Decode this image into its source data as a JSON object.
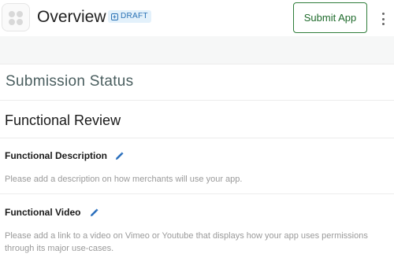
{
  "header": {
    "app_icon": "app-placeholder-icon",
    "title": "Overview",
    "badge": {
      "icon": "plus-square-icon",
      "label": "DRAFT"
    },
    "submit_label": "Submit App",
    "more_icon": "kebab-menu-icon"
  },
  "main": {
    "status_heading": "Submission Status",
    "section_title": "Functional Review",
    "fields": [
      {
        "label": "Functional Description",
        "edit_icon": "pencil-icon",
        "hint": "Please add a description on how merchants will use your app."
      },
      {
        "label": "Functional Video",
        "edit_icon": "pencil-icon",
        "hint": "Please add a link to a video on Vimeo or Youtube that displays how your app uses permissions through its major use-cases."
      }
    ]
  },
  "colors": {
    "accent_green": "#2f7d3a",
    "badge_bg": "#e3f1fb",
    "badge_text": "#2a72b5",
    "pencil": "#2a6fbd",
    "hint_text": "#9a9a9a"
  }
}
